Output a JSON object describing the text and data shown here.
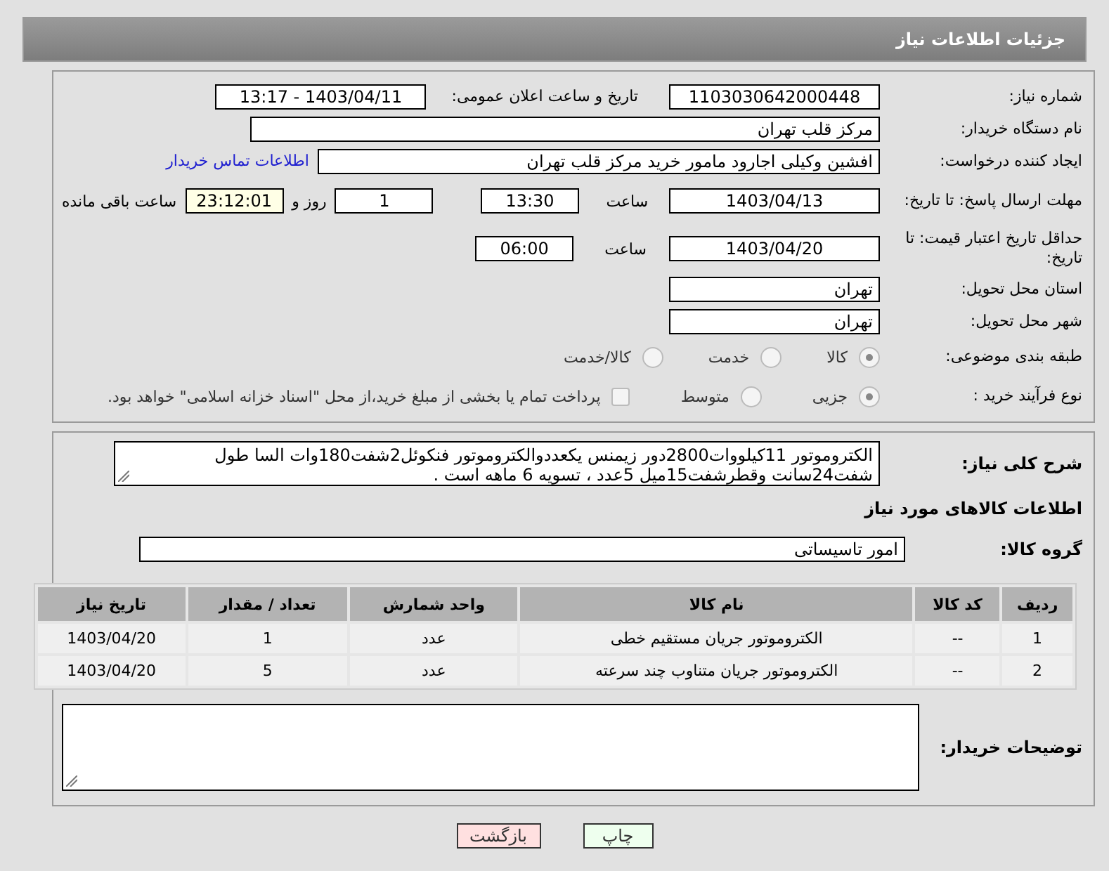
{
  "header": {
    "title": "جزئیات اطلاعات نیاز"
  },
  "need_number": {
    "label": "شماره نیاز:",
    "value": "1103030642000448"
  },
  "announce": {
    "label": "تاریخ و ساعت اعلان عمومی:",
    "value": "1403/04/11 - 13:17"
  },
  "buyer_org": {
    "label": "نام دستگاه خریدار:",
    "value": "مرکز قلب تهران"
  },
  "requester": {
    "label": "ایجاد کننده درخواست:",
    "value": "افشین وکیلی اجارود مامور خرید مرکز قلب تهران",
    "link": "اطلاعات تماس خریدار"
  },
  "reply_deadline": {
    "label": "مهلت ارسال پاسخ: تا تاریخ:",
    "date": "1403/04/13",
    "time_label": "ساعت",
    "time": "13:30",
    "days": "1",
    "days_label": "روز و",
    "remaining": "23:12:01",
    "remaining_label": "ساعت باقی مانده"
  },
  "price_validity": {
    "label": "حداقل تاریخ اعتبار قیمت: تا تاریخ:",
    "date": "1403/04/20",
    "time_label": "ساعت",
    "time": "06:00"
  },
  "province": {
    "label": "استان محل تحویل:",
    "value": "تهران"
  },
  "city": {
    "label": "شهر محل تحویل:",
    "value": "تهران"
  },
  "category": {
    "label": "طبقه بندی موضوعی:",
    "options": [
      {
        "label": "کالا",
        "selected": true
      },
      {
        "label": "خدمت",
        "selected": false
      },
      {
        "label": "کالا/خدمت",
        "selected": false
      }
    ]
  },
  "process": {
    "label": "نوع فرآیند خرید :",
    "options": [
      {
        "label": "جزیی",
        "selected": true
      },
      {
        "label": "متوسط",
        "selected": false
      }
    ],
    "checkbox": {
      "label": "پرداخت تمام یا بخشی از مبلغ خرید،از محل \"اسناد خزانه اسلامی\" خواهد بود.",
      "checked": false
    }
  },
  "description": {
    "label": "شرح کلی نیاز:",
    "value": "الکتروموتور 11کیلووات2800دور زیمنس یکعددوالکتروموتور فنکوئل2شفت180وات السا طول شفت24سانت وقطرشفت15میل 5عدد ، تسویه 6 ماهه است ."
  },
  "goods_heading": "اطلاعات کالاهای مورد نیاز",
  "goods_group": {
    "label": "گروه کالا:",
    "value": "امور تاسیساتی"
  },
  "table": {
    "columns": [
      "ردیف",
      "کد کالا",
      "نام کالا",
      "واحد شمارش",
      "تعداد / مقدار",
      "تاریخ نیاز"
    ],
    "rows": [
      [
        "1",
        "--",
        "الکتروموتور جریان مستقیم خطی",
        "عدد",
        "1",
        "1403/04/20"
      ],
      [
        "2",
        "--",
        "الکتروموتور جریان متناوب چند سرعته",
        "عدد",
        "5",
        "1403/04/20"
      ]
    ]
  },
  "buyer_notes": {
    "label": "توضیحات خریدار:"
  },
  "buttons": [
    {
      "label": "چاپ",
      "kind": "print"
    },
    {
      "label": "بازگشت",
      "kind": "back"
    }
  ]
}
